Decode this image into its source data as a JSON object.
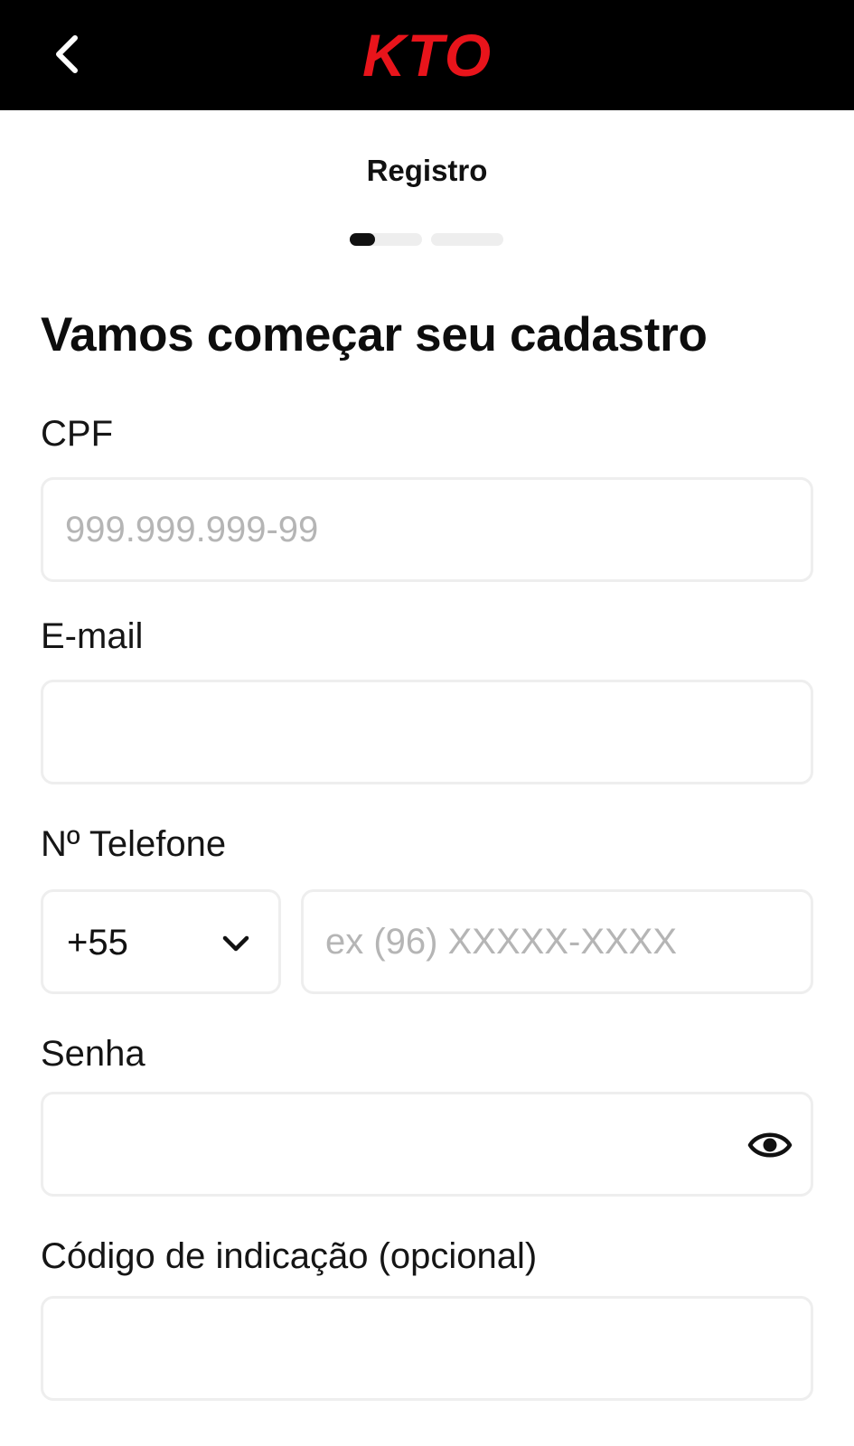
{
  "header": {
    "logo_text": "KTO",
    "brand_color": "#e8141b",
    "back_icon": "chevron-left-icon"
  },
  "registration": {
    "title": "Registro",
    "steps": {
      "total": 3,
      "current": 1,
      "current_progress": 0.35
    }
  },
  "form": {
    "heading": "Vamos começar seu cadastro",
    "cpf": {
      "label": "CPF",
      "placeholder": "999.999.999-99",
      "value": ""
    },
    "email": {
      "label": "E-mail",
      "placeholder": "",
      "value": ""
    },
    "phone": {
      "label": "Nº Telefone",
      "country_code": "+55",
      "placeholder": "ex (96) XXXXX-XXXX",
      "value": "",
      "dropdown_icon": "chevron-down-icon"
    },
    "password": {
      "label": "Senha",
      "value": "",
      "toggle_icon": "eye-icon"
    },
    "referral": {
      "label": "Código de indicação (opcional)",
      "placeholder": "",
      "value": ""
    }
  }
}
